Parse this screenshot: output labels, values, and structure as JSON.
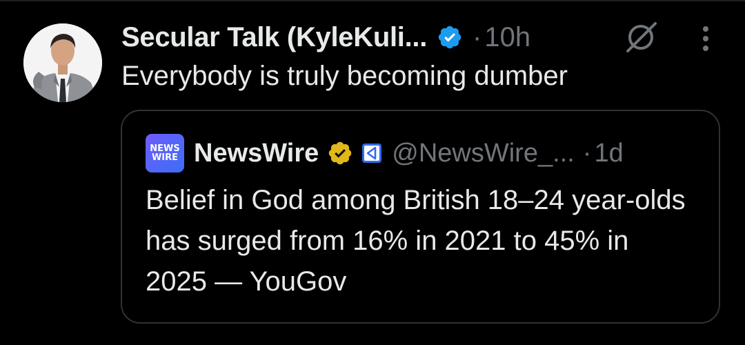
{
  "tweet": {
    "author_name": "Secular Talk (KyleKuli...",
    "separator": "·",
    "time": "10h",
    "text": "Everybody is truly becoming dumber",
    "icons": {
      "verified": "verified-badge-icon",
      "grok": "grok-icon",
      "more": "more-vertical-icon"
    }
  },
  "quote": {
    "avatar_line1": "NEWS",
    "avatar_line2": "WIRE",
    "name": "NewsWire",
    "handle": "@NewsWire_...",
    "separator": "·",
    "time": "1d",
    "text": "Belief in God among British 18–24 year-olds has surged from 16% in 2021 to 45% in 2025 — YouGov",
    "icons": {
      "verified": "gold-verified-badge-icon",
      "affiliate": "affiliate-badge-icon"
    }
  },
  "colors": {
    "background": "#000000",
    "primary_text": "#e7e9ea",
    "secondary_text": "#71767b",
    "blue_check": "#1d9bf0",
    "gold_check": "#e2b719",
    "card_border": "#2f3336"
  }
}
